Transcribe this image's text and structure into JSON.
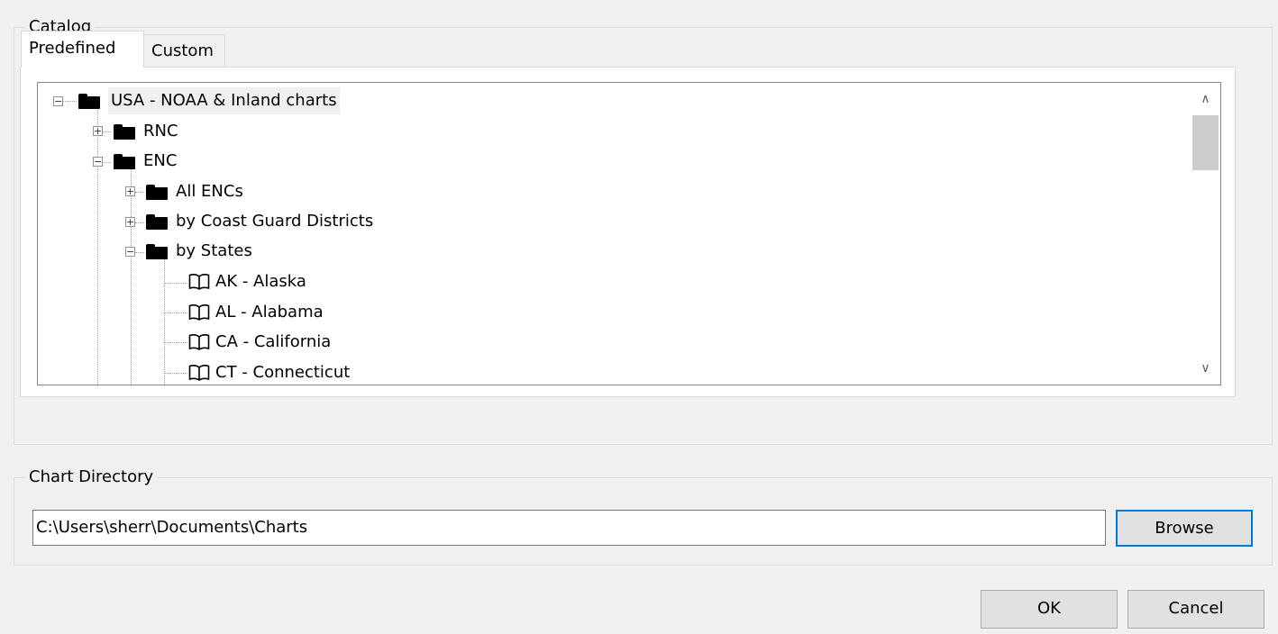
{
  "catalog": {
    "title": "Catalog",
    "tabs": [
      {
        "label": "Predefined",
        "active": true
      },
      {
        "label": "Custom",
        "active": false
      }
    ],
    "tree": [
      {
        "label": "USA - NOAA & Inland charts",
        "icon": "folder-icon",
        "expander": "−",
        "selected": true
      },
      {
        "label": "RNC",
        "icon": "folder-icon",
        "expander": "+"
      },
      {
        "label": "ENC",
        "icon": "folder-icon",
        "expander": "−"
      },
      {
        "label": "All ENCs",
        "icon": "folder-icon",
        "expander": "+"
      },
      {
        "label": "by Coast Guard Districts",
        "icon": "folder-icon",
        "expander": "+"
      },
      {
        "label": "by States",
        "icon": "folder-icon",
        "expander": "−"
      },
      {
        "label": "AK - Alaska",
        "icon": "book-icon"
      },
      {
        "label": "AL - Alabama",
        "icon": "book-icon"
      },
      {
        "label": "CA - California",
        "icon": "book-icon"
      },
      {
        "label": "CT - Connecticut",
        "icon": "book-icon"
      }
    ],
    "scrollbar": {
      "up": "∧",
      "down": "∨"
    }
  },
  "chart_directory": {
    "title": "Chart Directory",
    "path_value": "C:\\Users\\sherr\\Documents\\Charts",
    "browse_label": "Browse"
  },
  "dialog": {
    "ok_label": "OK",
    "cancel_label": "Cancel"
  },
  "colors": {
    "background": "#f0f0f0",
    "focus_border": "#0078d7"
  }
}
